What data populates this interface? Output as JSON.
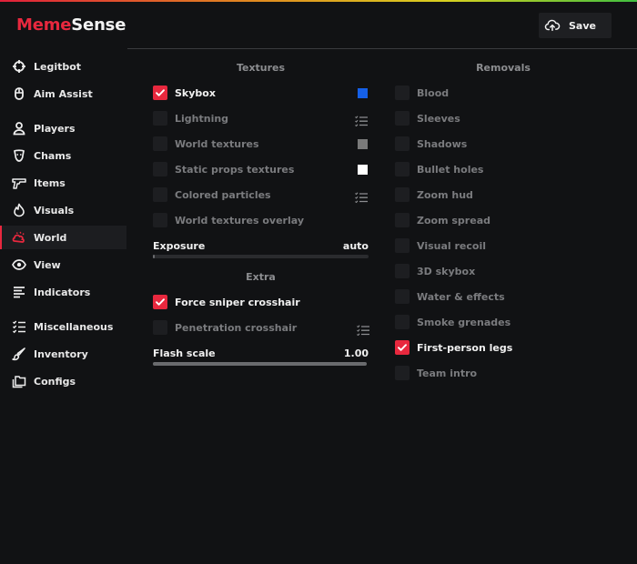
{
  "app": {
    "logo_part1": "Meme",
    "logo_part2": "Sense"
  },
  "header": {
    "save_label": "Save"
  },
  "sidebar": {
    "items": [
      {
        "label": "Legitbot",
        "icon": "crosshair-icon"
      },
      {
        "label": "Aim Assist",
        "icon": "mouse-icon"
      },
      {
        "label": "Players",
        "icon": "person-icon"
      },
      {
        "label": "Chams",
        "icon": "chams-icon"
      },
      {
        "label": "Items",
        "icon": "gun-icon"
      },
      {
        "label": "Visuals",
        "icon": "flame-icon"
      },
      {
        "label": "World",
        "icon": "world-icon",
        "active": true
      },
      {
        "label": "View",
        "icon": "eye-icon"
      },
      {
        "label": "Indicators",
        "icon": "indicators-icon"
      },
      {
        "label": "Miscellaneous",
        "icon": "misc-list-icon"
      },
      {
        "label": "Inventory",
        "icon": "brush-icon"
      },
      {
        "label": "Configs",
        "icon": "folders-icon"
      }
    ]
  },
  "textures": {
    "title": "Textures",
    "items": [
      {
        "label": "Skybox",
        "checked": true,
        "extra": "swatch",
        "color": "#1560e8"
      },
      {
        "label": "Lightning",
        "checked": false,
        "extra": "list"
      },
      {
        "label": "World textures",
        "checked": false,
        "extra": "swatch",
        "color": "#7a7a7a"
      },
      {
        "label": "Static props textures",
        "checked": false,
        "extra": "swatch",
        "color": "#ffffff"
      },
      {
        "label": "Colored particles",
        "checked": false,
        "extra": "list"
      },
      {
        "label": "World textures overlay",
        "checked": false
      }
    ],
    "exposure": {
      "label": "Exposure",
      "value": "auto",
      "fill": 0.0
    }
  },
  "extra": {
    "title": "Extra",
    "items": [
      {
        "label": "Force sniper crosshair",
        "checked": true
      },
      {
        "label": "Penetration crosshair",
        "checked": false,
        "extra": "list"
      }
    ],
    "flash_scale": {
      "label": "Flash scale",
      "value": "1.00",
      "fill": 1.0
    }
  },
  "removals": {
    "title": "Removals",
    "items": [
      {
        "label": "Blood",
        "checked": false
      },
      {
        "label": "Sleeves",
        "checked": false
      },
      {
        "label": "Shadows",
        "checked": false
      },
      {
        "label": "Bullet holes",
        "checked": false
      },
      {
        "label": "Zoom hud",
        "checked": false
      },
      {
        "label": "Zoom spread",
        "checked": false
      },
      {
        "label": "Visual recoil",
        "checked": false
      },
      {
        "label": "3D skybox",
        "checked": false
      },
      {
        "label": "Water & effects",
        "checked": false
      },
      {
        "label": "Smoke grenades",
        "checked": false
      },
      {
        "label": "First-person legs",
        "checked": true
      },
      {
        "label": "Team intro",
        "checked": false
      }
    ]
  },
  "colors": {
    "accent": "#e8283e",
    "background": "#111214"
  }
}
